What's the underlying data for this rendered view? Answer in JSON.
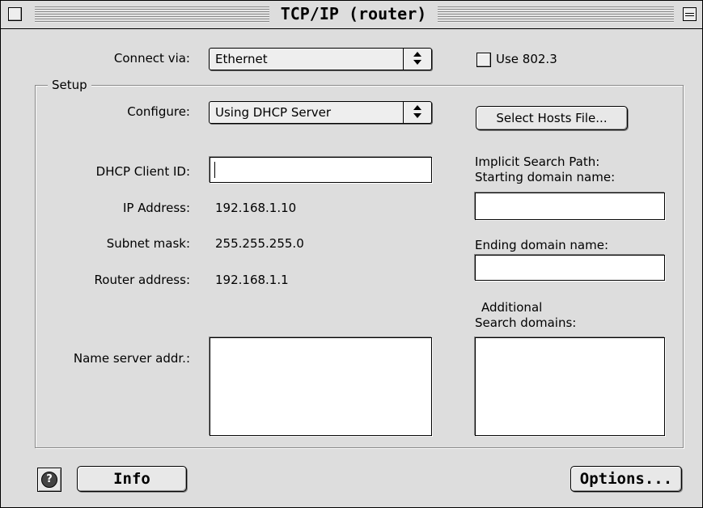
{
  "window": {
    "title": "TCP/IP (router)"
  },
  "connect": {
    "label": "Connect via:",
    "value": "Ethernet",
    "use8023_label": "Use 802.3",
    "use8023_checked": false
  },
  "setup": {
    "group_label": "Setup",
    "configure_label": "Configure:",
    "configure_value": "Using DHCP Server",
    "select_hosts_label": "Select Hosts File...",
    "dhcp_client_id_label": "DHCP Client ID:",
    "dhcp_client_id_value": "",
    "ip_address_label": "IP Address:",
    "ip_address_value": "192.168.1.10",
    "subnet_mask_label": "Subnet mask:",
    "subnet_mask_value": "255.255.255.0",
    "router_address_label": "Router address:",
    "router_address_value": "192.168.1.1",
    "name_server_label": "Name server addr.:",
    "name_server_value": "",
    "implicit_search_path_label": "Implicit Search Path:",
    "starting_domain_label": "Starting domain name:",
    "starting_domain_value": "",
    "ending_domain_label": "Ending domain name:",
    "ending_domain_value": "",
    "additional_label": "Additional",
    "search_domains_label": "Search domains:",
    "search_domains_value": ""
  },
  "footer": {
    "help_glyph": "?",
    "info_label": "Info",
    "options_label": "Options..."
  },
  "icons": {
    "close_box": "close-box-icon",
    "collapse_box": "collapse-box-icon",
    "help": "help-icon",
    "popup_arrows": "up-down-arrows-icon"
  }
}
